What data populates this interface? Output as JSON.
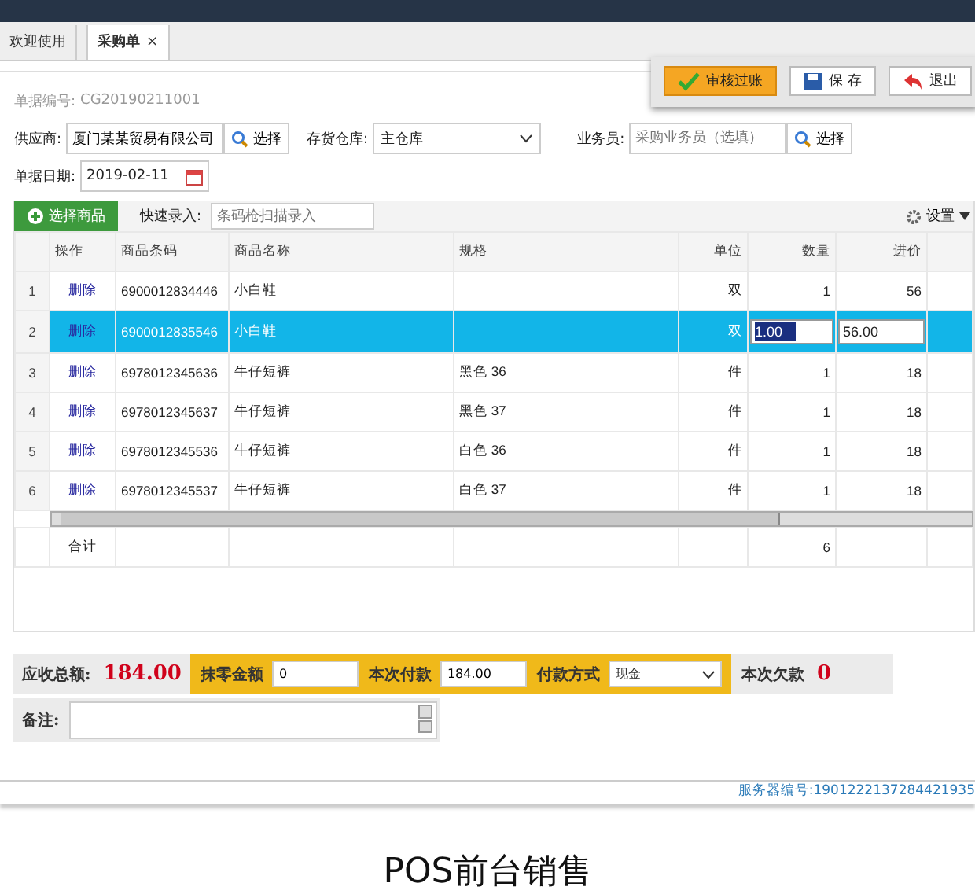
{
  "tabs": [
    {
      "label": "欢迎使用",
      "selected": false
    },
    {
      "label": "采购单",
      "selected": true,
      "close": "×"
    }
  ],
  "toolbar": [
    {
      "kind": "approve",
      "label": "审核过账"
    },
    {
      "kind": "save",
      "label": "保 存"
    },
    {
      "kind": "exit",
      "label": "退出"
    }
  ],
  "form": {
    "doc_no_label": "单据编号:",
    "doc_no": "CG20190211001",
    "supplier_label": "供应商:",
    "supplier": "厦门某某贸易有限公司",
    "supplier_pick": "选择",
    "warehouse_label": "存货仓库:",
    "warehouse": "主仓库",
    "clerk_label": "业务员:",
    "clerk_placeholder": "采购业务员（选填）",
    "clerk_pick": "选择",
    "date_label": "单据日期:",
    "date": "2019-02-11"
  },
  "grid_toolbar": {
    "add": "选择商品",
    "quick_label": "快速录入:",
    "quick_placeholder": "条码枪扫描录入",
    "settings": "设置"
  },
  "table": {
    "columns": [
      "操作",
      "商品条码",
      "商品名称",
      "规格",
      "单位",
      "数量",
      "进价"
    ],
    "rows": [
      {
        "no": "1",
        "action": "删除",
        "barcode": "6900012834446",
        "name": "小白鞋",
        "spec": "",
        "unit": "双",
        "qty": "1",
        "price": "56",
        "selected": false
      },
      {
        "no": "2",
        "action": "删除",
        "barcode": "6900012835546",
        "name": "小白鞋",
        "spec": "",
        "unit": "双",
        "qty": "1.00",
        "price": "56.00",
        "selected": true
      },
      {
        "no": "3",
        "action": "删除",
        "barcode": "6978012345636",
        "name": "牛仔短裤",
        "spec": "黑色 36",
        "unit": "件",
        "qty": "1",
        "price": "18",
        "selected": false
      },
      {
        "no": "4",
        "action": "删除",
        "barcode": "6978012345637",
        "name": "牛仔短裤",
        "spec": "黑色 37",
        "unit": "件",
        "qty": "1",
        "price": "18",
        "selected": false
      },
      {
        "no": "5",
        "action": "删除",
        "barcode": "6978012345536",
        "name": "牛仔短裤",
        "spec": "白色 36",
        "unit": "件",
        "qty": "1",
        "price": "18",
        "selected": false
      },
      {
        "no": "6",
        "action": "删除",
        "barcode": "6978012345537",
        "name": "牛仔短裤",
        "spec": "白色 37",
        "unit": "件",
        "qty": "1",
        "price": "18",
        "selected": false
      }
    ],
    "total_label": "合计",
    "total_qty": "6"
  },
  "payment": {
    "due_label": "应收总额:",
    "due": "184.00",
    "rounding_label": "抹零金额",
    "rounding": "0",
    "paid_label": "本次付款",
    "paid": "184.00",
    "method_label": "付款方式",
    "method": "现金",
    "owed_label": "本次欠款",
    "owed": "0"
  },
  "note": {
    "label": "备注:"
  },
  "status_bar": {
    "server": "服务器编号:1901222137284421935"
  },
  "caption": "POS前台销售"
}
